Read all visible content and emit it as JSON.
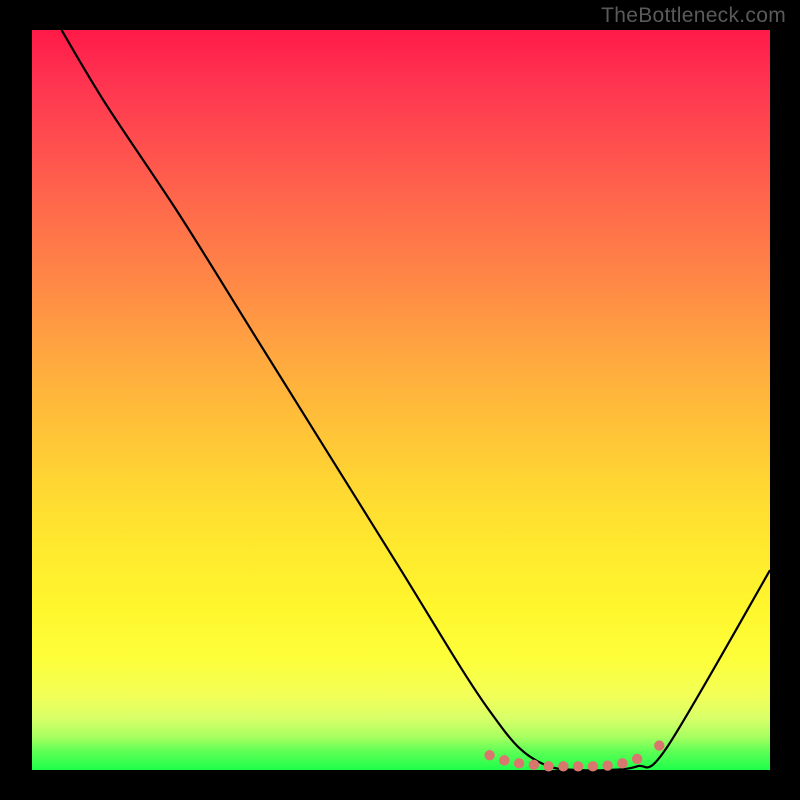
{
  "watermark": "TheBottleneck.com",
  "chart_data": {
    "type": "line",
    "title": "",
    "xlabel": "",
    "ylabel": "",
    "xlim": [
      0,
      100
    ],
    "ylim": [
      0,
      100
    ],
    "series": [
      {
        "name": "bottleneck-curve",
        "x": [
          4,
          10,
          20,
          30,
          40,
          50,
          58,
          62,
          66,
          70,
          74,
          78,
          82,
          86,
          100
        ],
        "y": [
          100,
          90,
          75,
          59,
          43,
          27,
          14,
          8,
          3,
          0.5,
          0,
          0,
          0.5,
          3,
          27
        ]
      }
    ],
    "markers": {
      "name": "min-region-dots",
      "color": "#d9776f",
      "x": [
        62,
        64,
        66,
        68,
        70,
        72,
        74,
        76,
        78,
        80,
        82,
        85
      ],
      "y": [
        2.0,
        1.3,
        0.9,
        0.7,
        0.5,
        0.5,
        0.5,
        0.5,
        0.6,
        0.9,
        1.5,
        3.3
      ]
    }
  }
}
